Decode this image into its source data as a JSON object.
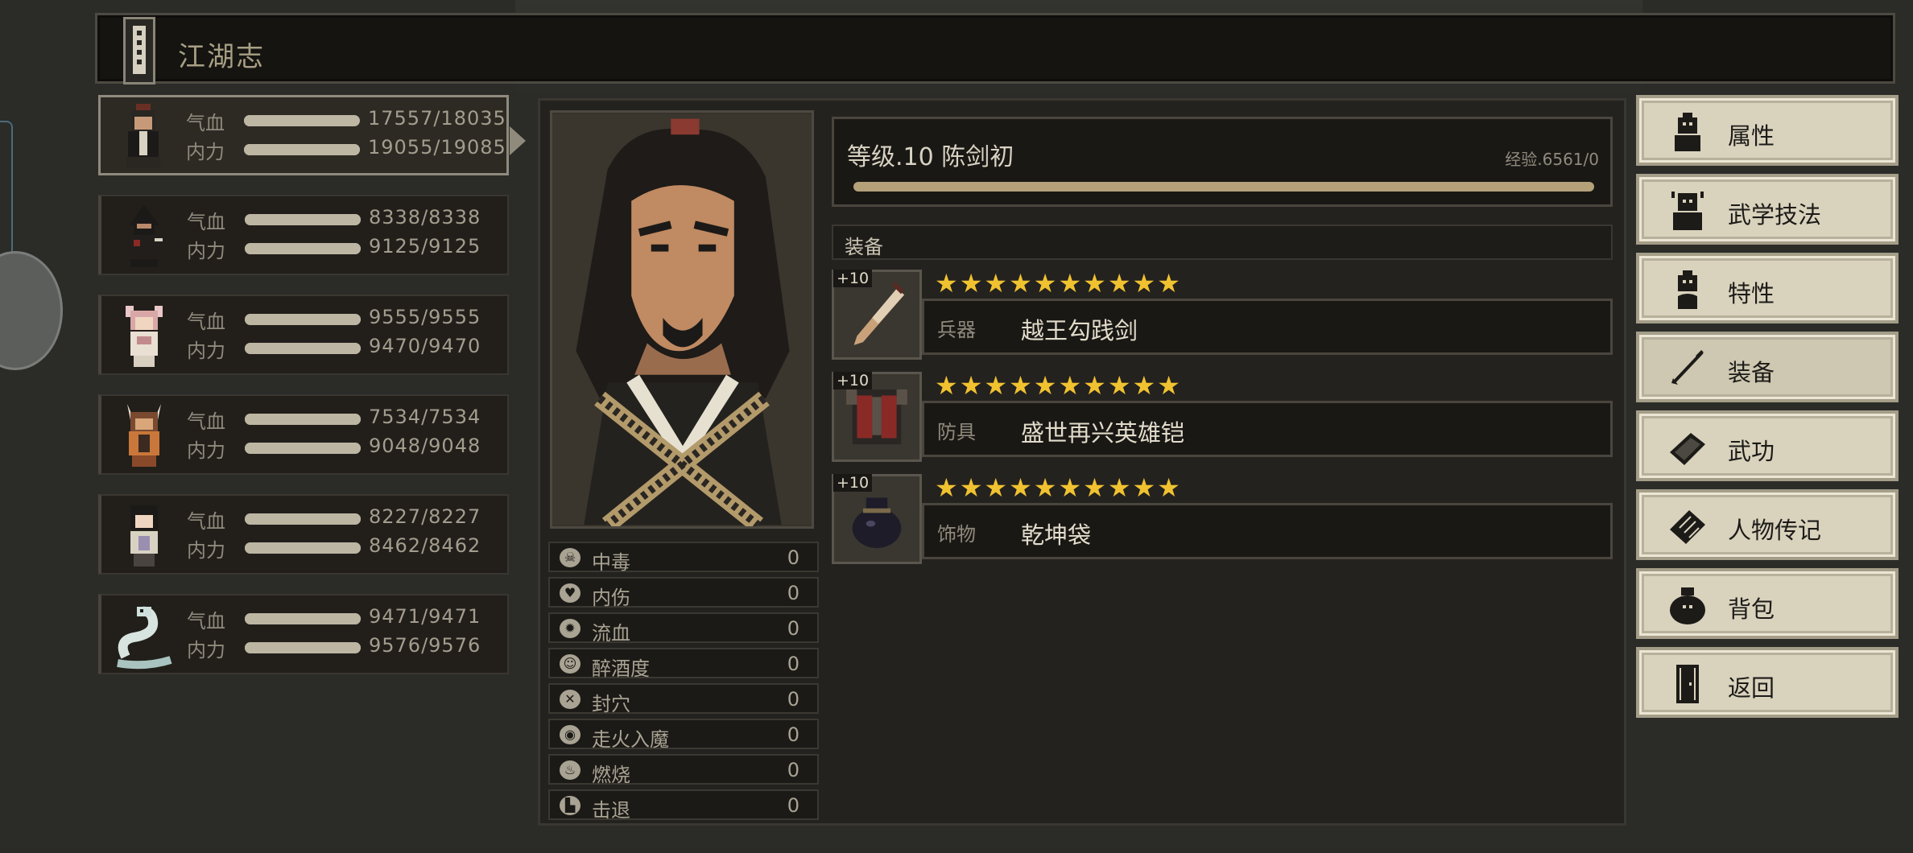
{
  "title": "江湖志",
  "party": [
    {
      "hp_label": "气血",
      "hp": "17557/18035",
      "hp_frac": 0.973,
      "mp_label": "内力",
      "mp": "19055/19085",
      "mp_frac": 0.998,
      "selected": true
    },
    {
      "hp_label": "气血",
      "hp": "8338/8338",
      "hp_frac": 1.0,
      "mp_label": "内力",
      "mp": "9125/9125",
      "mp_frac": 1.0
    },
    {
      "hp_label": "气血",
      "hp": "9555/9555",
      "hp_frac": 1.0,
      "mp_label": "内力",
      "mp": "9470/9470",
      "mp_frac": 1.0
    },
    {
      "hp_label": "气血",
      "hp": "7534/7534",
      "hp_frac": 1.0,
      "mp_label": "内力",
      "mp": "9048/9048",
      "mp_frac": 1.0
    },
    {
      "hp_label": "气血",
      "hp": "8227/8227",
      "hp_frac": 1.0,
      "mp_label": "内力",
      "mp": "8462/8462",
      "mp_frac": 1.0
    },
    {
      "hp_label": "气血",
      "hp": "9471/9471",
      "hp_frac": 1.0,
      "mp_label": "内力",
      "mp": "9576/9576",
      "mp_frac": 1.0
    }
  ],
  "character": {
    "level_text": "等级.10 陈剑初",
    "exp_text": "经验.6561/0",
    "exp_frac": 1.0
  },
  "equipment_section": "装备",
  "equipment": [
    {
      "plus": "+10",
      "stars": "★★★★★★★★★★",
      "type": "兵器",
      "name": "越王勾践剑",
      "icon": "sword-icon"
    },
    {
      "plus": "+10",
      "stars": "★★★★★★★★★★",
      "type": "防具",
      "name": "盛世再兴英雄铠",
      "icon": "armor-icon"
    },
    {
      "plus": "+10",
      "stars": "★★★★★★★★★★",
      "type": "饰物",
      "name": "乾坤袋",
      "icon": "pouch-icon"
    }
  ],
  "status_effects": [
    {
      "label": "中毒",
      "value": "0",
      "icon": "skull-icon"
    },
    {
      "label": "内伤",
      "value": "0",
      "icon": "broken-heart-icon"
    },
    {
      "label": "流血",
      "value": "0",
      "icon": "blood-icon"
    },
    {
      "label": "醉酒度",
      "value": "0",
      "icon": "drunk-icon"
    },
    {
      "label": "封穴",
      "value": "0",
      "icon": "acupoint-icon"
    },
    {
      "label": "走火入魔",
      "value": "0",
      "icon": "demon-icon"
    },
    {
      "label": "燃烧",
      "value": "0",
      "icon": "fire-icon"
    },
    {
      "label": "击退",
      "value": "0",
      "icon": "boot-icon"
    }
  ],
  "menu": [
    {
      "label": "属性",
      "icon": "person-icon"
    },
    {
      "label": "武学技法",
      "icon": "skills-icon"
    },
    {
      "label": "特性",
      "icon": "trait-icon"
    },
    {
      "label": "装备",
      "icon": "sword-icon",
      "active": true
    },
    {
      "label": "武功",
      "icon": "book-icon"
    },
    {
      "label": "人物传记",
      "icon": "scroll-icon"
    },
    {
      "label": "背包",
      "icon": "bag-icon"
    },
    {
      "label": "返回",
      "icon": "door-icon"
    }
  ],
  "colors": {
    "background": "#2b2c28",
    "panel": "#24221f",
    "star": "#f0c230",
    "menu_button": "#d9d2bd",
    "exp_bar": "#b4a17a"
  }
}
